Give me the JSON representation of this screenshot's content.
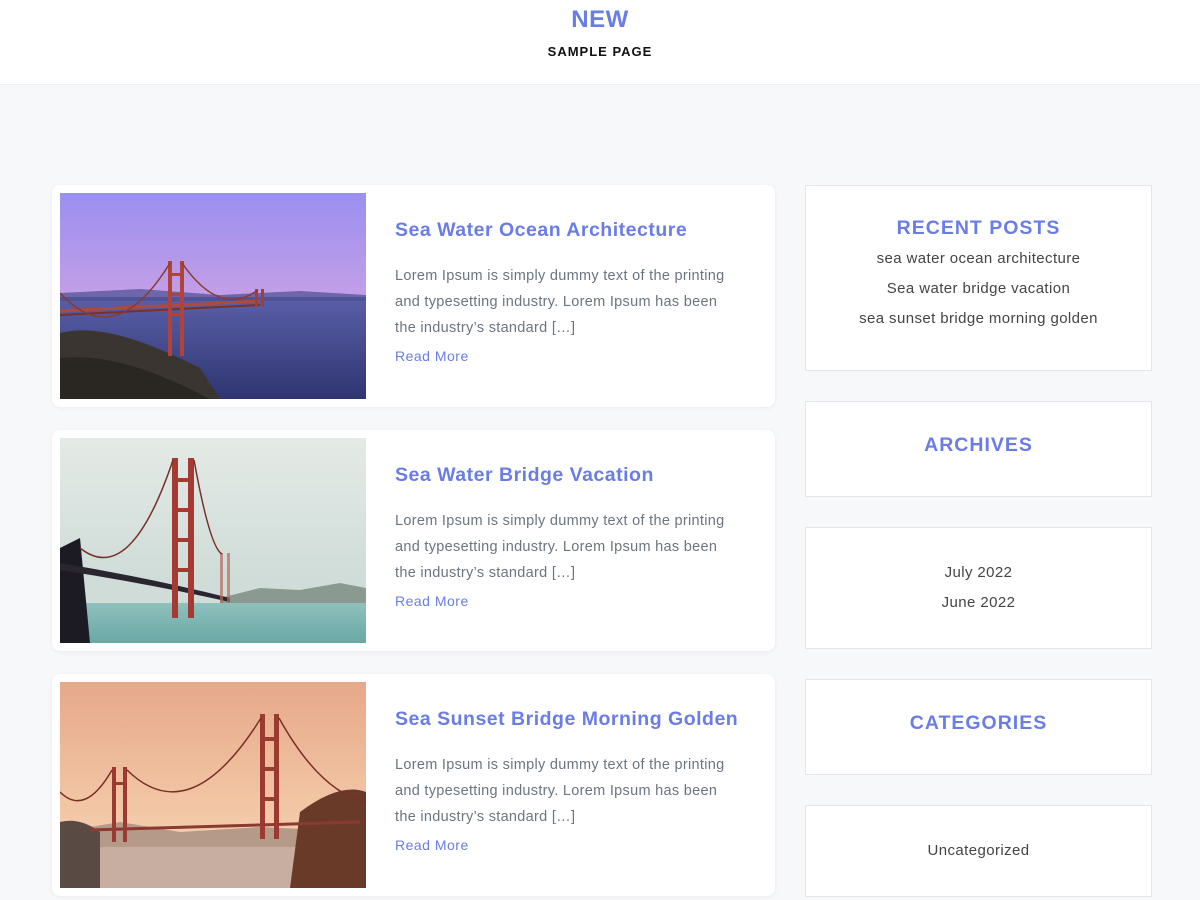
{
  "site": {
    "title": "NEW",
    "nav_item": "SAMPLE PAGE"
  },
  "colors": {
    "accent": "#6a7de6",
    "background": "#f7f8fa",
    "card": "#ffffff"
  },
  "posts": [
    {
      "title": "Sea Water Ocean Architecture",
      "excerpt": "Lorem Ipsum is simply dummy text of the printing and typesetting industry. Lorem Ipsum has been the industry’s standard […]",
      "read_more": "Read More",
      "image": "golden-gate-bridge-purple-dusk"
    },
    {
      "title": "Sea Water Bridge Vacation",
      "excerpt": "Lorem Ipsum is simply dummy text of the printing and typesetting industry. Lorem Ipsum has been the industry’s standard […]",
      "read_more": "Read More",
      "image": "golden-gate-bridge-hazy-day"
    },
    {
      "title": "Sea Sunset Bridge Morning Golden",
      "excerpt": "Lorem Ipsum is simply dummy text of the printing and typesetting industry. Lorem Ipsum has been the industry’s standard […]",
      "read_more": "Read More",
      "image": "golden-gate-bridge-golden-sunset"
    }
  ],
  "sidebar": {
    "recent_posts": {
      "title": "RECENT POSTS",
      "items": [
        "sea water ocean architecture",
        "Sea water bridge vacation",
        "sea sunset bridge morning golden"
      ]
    },
    "archives": {
      "title": "ARCHIVES",
      "items": [
        "July 2022",
        "June 2022"
      ]
    },
    "categories": {
      "title": "CATEGORIES",
      "items": [
        "Uncategorized"
      ]
    }
  }
}
